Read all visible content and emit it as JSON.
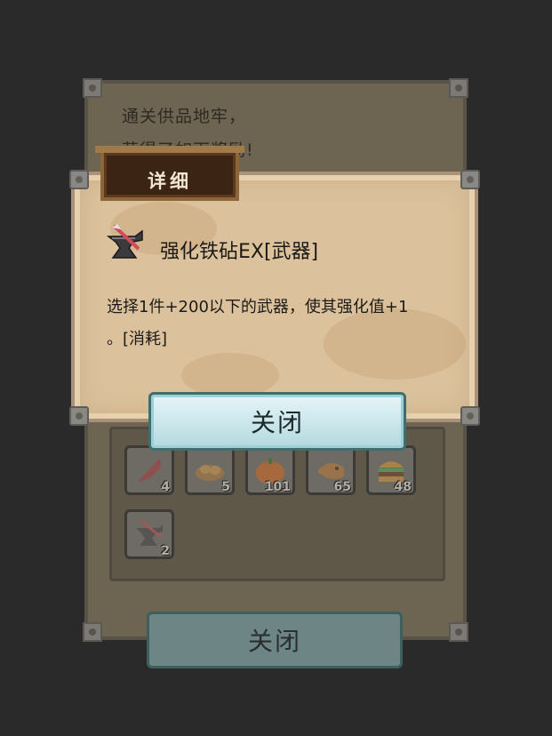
{
  "background_dialog": {
    "message_line1": "通关供品地牢，",
    "message_line2": "获得了如下奖励!",
    "items": [
      {
        "icon": "feather-icon",
        "count": "4"
      },
      {
        "icon": "bread-icon",
        "count": "5"
      },
      {
        "icon": "pumpkin-icon",
        "count": "101"
      },
      {
        "icon": "taiyaki-icon",
        "count": "65"
      },
      {
        "icon": "burger-icon",
        "count": "48"
      },
      {
        "icon": "anvil-icon",
        "count": "2"
      }
    ],
    "close_label": "关闭"
  },
  "detail_dialog": {
    "title": "详细",
    "item_name": "强化铁砧EX[武器]",
    "description_line1": "选择1件+200以下的武器，使其强化值+1",
    "description_line2": "。[消耗]",
    "item_icon": "anvil-icon",
    "close_label": "关闭"
  },
  "colors": {
    "parchment": "#dcc29c",
    "close_button": "#cfe9ee",
    "title_tab": "#3b2413"
  }
}
